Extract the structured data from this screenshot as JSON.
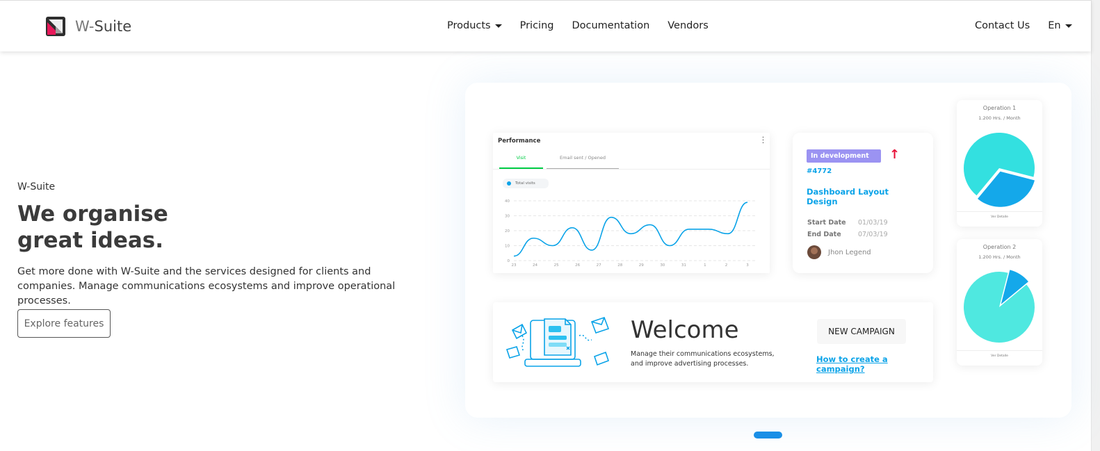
{
  "header": {
    "brand_prefix": "W-",
    "brand_name": "Suite",
    "nav": [
      {
        "label": "Products",
        "dropdown": true
      },
      {
        "label": "Pricing"
      },
      {
        "label": "Documentation"
      },
      {
        "label": "Vendors"
      }
    ],
    "contact_label": "Contact Us",
    "language_label": "En"
  },
  "hero": {
    "eyebrow": "W-Suite",
    "headline_line1": "We organise",
    "headline_line2": "great ideas.",
    "description": "Get more done with W-Suite and the services designed for clients and companies. Manage communications ecosystems and improve operational processes.",
    "cta_label": "Explore features"
  },
  "performance_card": {
    "title": "Performance",
    "tabs": [
      "Visit",
      "Email sent / Opened"
    ],
    "legend": "Total visits",
    "chart_data": {
      "type": "line",
      "x": [
        "23",
        "24",
        "25",
        "26",
        "27",
        "28",
        "29",
        "30",
        "31",
        "1",
        "2",
        "3"
      ],
      "series": [
        {
          "name": "Total visits",
          "values": [
            3,
            15,
            10,
            22,
            7,
            29,
            18,
            24,
            10,
            21,
            21,
            18,
            39
          ]
        }
      ],
      "ylim": [
        0,
        40
      ],
      "yticks": [
        "0",
        "10",
        "20",
        "30",
        "40"
      ],
      "grid": true,
      "colors": {
        "line": "#0aa3e8"
      }
    }
  },
  "task_card": {
    "status": "In development",
    "id": "#4772",
    "title": "Dashboard Layout Design",
    "start_label": "Start Date",
    "start_value": "01/03/19",
    "end_label": "End Date",
    "end_value": "07/03/19",
    "assignee": "Jhon Legend",
    "colors": {
      "badge": "#9b93f2",
      "accent": "#0aa3e8",
      "arrow": "#e8133a"
    }
  },
  "welcome_card": {
    "title": "Welcome",
    "subtitle_line1": "Manage their communications ecosystems,",
    "subtitle_line2": "and improve advertising processes.",
    "button_label": "NEW CAMPAIGN",
    "link_label": "How to create a campaign?"
  },
  "operations": [
    {
      "title": "Operation 1",
      "subtitle": "1.200 Hrs. / Month",
      "footer": "Ver Detalle",
      "slice_percent": 32
    },
    {
      "title": "Operation 2",
      "subtitle": "1.200 Hrs. / Month",
      "footer": "Ver Detalle",
      "slice_percent": 10
    }
  ],
  "colors": {
    "primary": "#0aa3e8",
    "pager": "#1a8fe6"
  }
}
